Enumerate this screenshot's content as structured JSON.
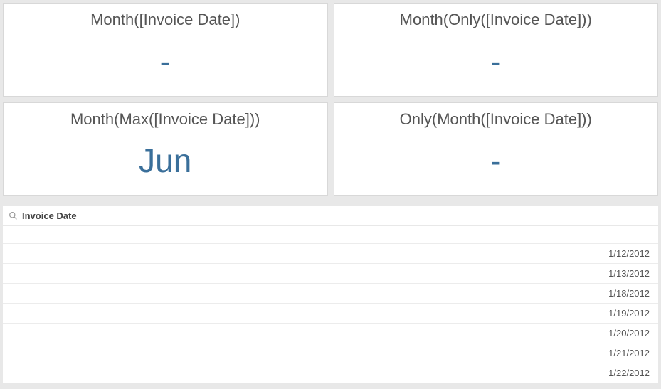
{
  "kpis": [
    {
      "title": "Month([Invoice Date])",
      "value": "-"
    },
    {
      "title": "Month(Only([Invoice Date]))",
      "value": "-"
    },
    {
      "title": "Month(Max([Invoice Date]))",
      "value": "Jun"
    },
    {
      "title": "Only(Month([Invoice Date]))",
      "value": "-"
    }
  ],
  "list": {
    "header": "Invoice Date",
    "rows": [
      "1/12/2012",
      "1/13/2012",
      "1/18/2012",
      "1/19/2012",
      "1/20/2012",
      "1/21/2012",
      "1/22/2012"
    ]
  }
}
